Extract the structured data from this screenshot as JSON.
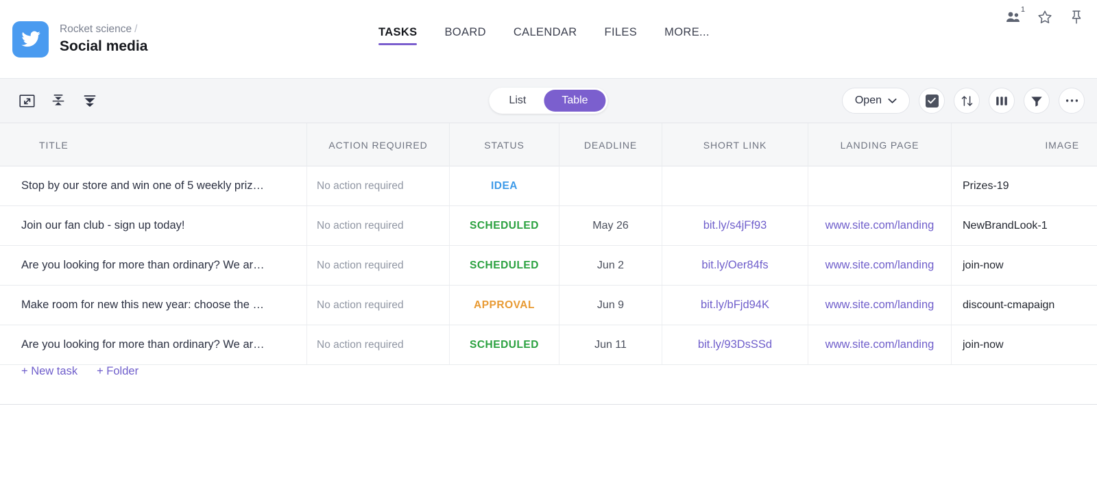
{
  "header": {
    "logo_icon": "twitter-bird-icon",
    "logo_color": "#4a9bf0",
    "breadcrumb_parent": "Rocket science",
    "breadcrumb_separator": "/",
    "title": "Social media",
    "nav": [
      {
        "label": "TASKS",
        "active": true
      },
      {
        "label": "BOARD",
        "active": false
      },
      {
        "label": "CALENDAR",
        "active": false
      },
      {
        "label": "FILES",
        "active": false
      },
      {
        "label": "MORE...",
        "active": false
      }
    ],
    "nav_active_color": "#7b5fce",
    "icons": [
      {
        "name": "people-icon",
        "badge": "1"
      },
      {
        "name": "star-icon",
        "badge": ""
      },
      {
        "name": "pin-icon",
        "badge": ""
      }
    ]
  },
  "toolbar": {
    "left_icons": [
      {
        "name": "fullscreen-icon"
      },
      {
        "name": "collapse-all-icon"
      },
      {
        "name": "expand-all-icon"
      }
    ],
    "view_toggle": {
      "options": [
        {
          "label": "List",
          "active": false
        },
        {
          "label": "Table",
          "active": true
        }
      ],
      "active_color": "#7b5fce"
    },
    "filter_dropdown_label": "Open",
    "right_icons": [
      {
        "name": "checkbox-icon"
      },
      {
        "name": "sort-icon"
      },
      {
        "name": "columns-icon"
      },
      {
        "name": "filter-icon"
      },
      {
        "name": "more-options-icon"
      }
    ]
  },
  "table": {
    "columns": [
      "TITLE",
      "ACTION REQUIRED",
      "STATUS",
      "DEADLINE",
      "SHORT LINK",
      "LANDING PAGE",
      "IMAGE"
    ],
    "rows": [
      {
        "title": "Stop by our store and win one of 5 weekly priz…",
        "action": "No action required",
        "status": "IDEA",
        "status_color": "#3d9ae8",
        "deadline": "",
        "short_link": "",
        "landing_page": "",
        "image": "Prizes-19"
      },
      {
        "title": "Join our fan club - sign up today!",
        "action": "No action required",
        "status": "SCHEDULED",
        "status_color": "#2aa13f",
        "deadline": "May 26",
        "short_link": "bit.ly/s4jFf93",
        "landing_page": "www.site.com/landing",
        "image": "NewBrandLook-1"
      },
      {
        "title": "Are you looking for more than ordinary? We ar…",
        "action": "No action required",
        "status": "SCHEDULED",
        "status_color": "#2aa13f",
        "deadline": "Jun 2",
        "short_link": "bit.ly/Oer84fs",
        "landing_page": "www.site.com/landing",
        "image": "join-now"
      },
      {
        "title": "Make room for new this new year: choose the …",
        "action": "No action required",
        "status": "APPROVAL",
        "status_color": "#e89a33",
        "deadline": "Jun 9",
        "short_link": "bit.ly/bFjd94K",
        "landing_page": "www.site.com/landing",
        "image": "discount-cmapaign"
      },
      {
        "title": "Are you looking for more than ordinary? We ar…",
        "action": "No action required",
        "status": "SCHEDULED",
        "status_color": "#2aa13f",
        "deadline": "Jun 11",
        "short_link": "bit.ly/93DsSSd",
        "landing_page": "www.site.com/landing",
        "image": "join-now"
      }
    ],
    "add_row": {
      "new_task_label": "+ New task",
      "new_folder_label": "+ Folder",
      "link_color": "#6f5ecb"
    }
  }
}
